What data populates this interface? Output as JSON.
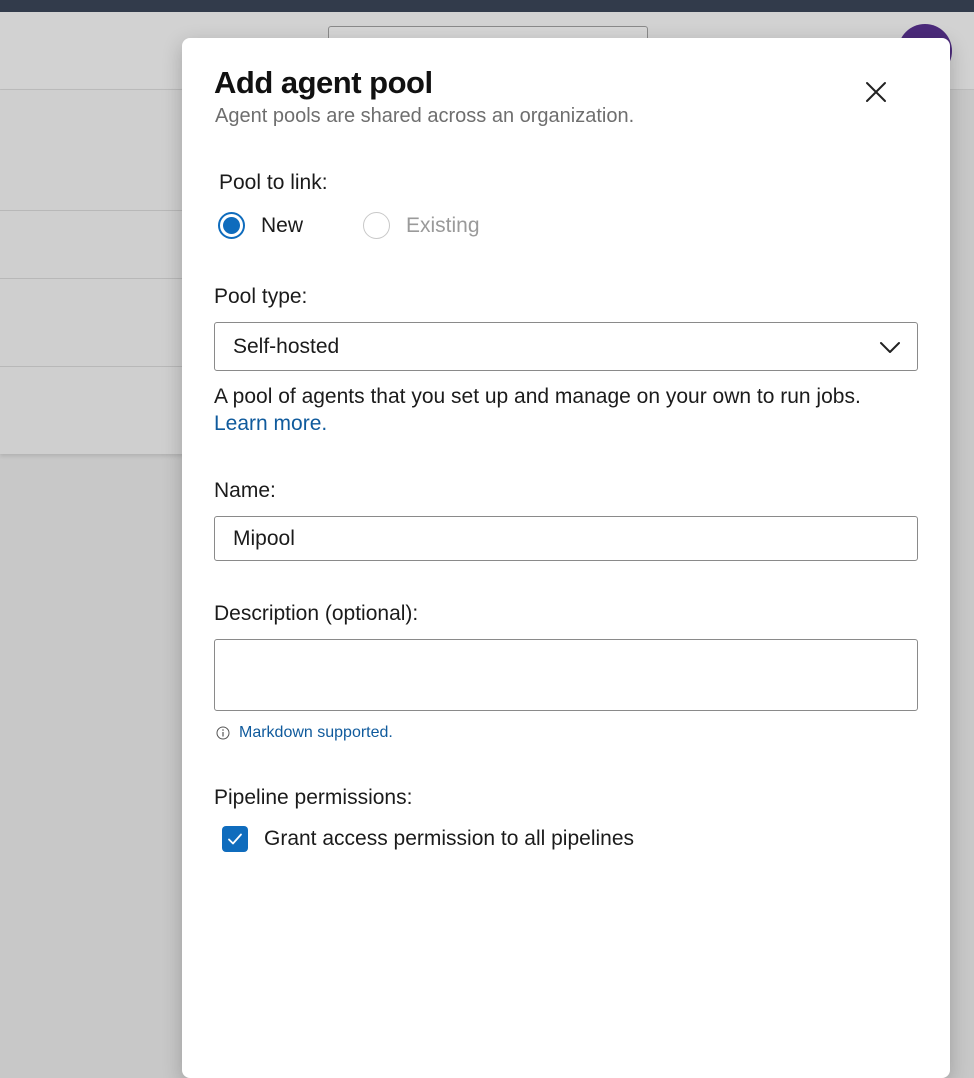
{
  "dialog": {
    "title": "Add agent pool",
    "subtitle": "Agent pools are shared across an organization.",
    "close_icon": "close-icon"
  },
  "pool_to_link": {
    "label": "Pool to link:",
    "options": [
      {
        "label": "New",
        "selected": true,
        "disabled": false
      },
      {
        "label": "Existing",
        "selected": false,
        "disabled": true
      }
    ]
  },
  "pool_type": {
    "label": "Pool type:",
    "value": "Self-hosted",
    "icon": "chevron-down-icon",
    "help_text": "A pool of agents that you set up and manage on your own to run jobs.",
    "help_link": "Learn more."
  },
  "name": {
    "label": "Name:",
    "value": "Mipool"
  },
  "description": {
    "label": "Description (optional):",
    "value": "",
    "note": "Markdown supported.",
    "note_icon": "info-icon"
  },
  "pipeline_permissions": {
    "label": "Pipeline permissions:",
    "checkbox_label": "Grant access permission to all pipelines",
    "checked": true
  },
  "colors": {
    "accent": "#0f6cbd",
    "link": "#0f5a9c"
  }
}
